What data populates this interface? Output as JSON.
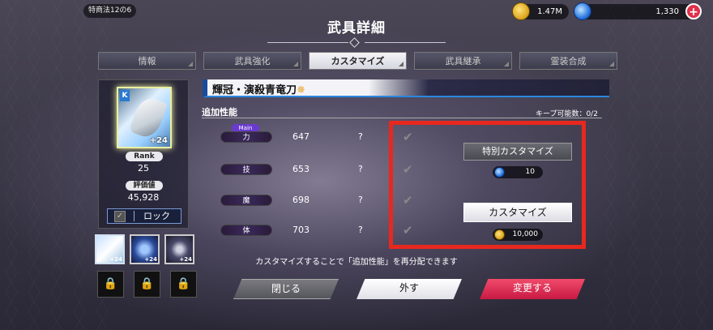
{
  "header": {
    "location": "特商法12の6",
    "title": "武具詳細",
    "gold": "1.47M",
    "gems": "1,330"
  },
  "tabs": [
    {
      "label": "情報",
      "active": false
    },
    {
      "label": "武具強化",
      "active": false
    },
    {
      "label": "カスタマイズ",
      "active": true
    },
    {
      "label": "武具継承",
      "active": false
    },
    {
      "label": "霊装合成",
      "active": false
    }
  ],
  "weapon": {
    "plus": "+24",
    "rank_label": "Rank",
    "rank": "25",
    "value_label": "評価値",
    "value": "45,928",
    "lock_label": "ロック",
    "name": "輝冠・演殺青竜刀"
  },
  "slots": [
    {
      "plus": "+24"
    },
    {
      "plus": "+24"
    },
    {
      "plus": "+24"
    }
  ],
  "section": {
    "label": "追加性能",
    "keep_count": "キープ可能数：0/2"
  },
  "stats": [
    {
      "tag": "Main",
      "name": "力",
      "value": "647",
      "q": "?"
    },
    {
      "tag": "",
      "name": "技",
      "value": "653",
      "q": "?"
    },
    {
      "tag": "",
      "name": "魔",
      "value": "698",
      "q": "?"
    },
    {
      "tag": "",
      "name": "体",
      "value": "703",
      "q": "?"
    }
  ],
  "actions": {
    "special_label": "特別カスタマイズ",
    "special_cost": "10",
    "custom_label": "カスタマイズ",
    "custom_cost": "10,000"
  },
  "footer": {
    "message": "カスタマイズすることで「追加性能」を再分配できます",
    "close": "閉じる",
    "remove": "外す",
    "change": "変更する"
  },
  "icons": {
    "gold": "coin-icon",
    "gem": "gem-icon",
    "lock": "padlock-icon",
    "check": "checkmark-icon"
  },
  "colors": {
    "highlight": "#e8281e",
    "accent_blue": "#2a88e0",
    "change_button": "#e0305a"
  }
}
